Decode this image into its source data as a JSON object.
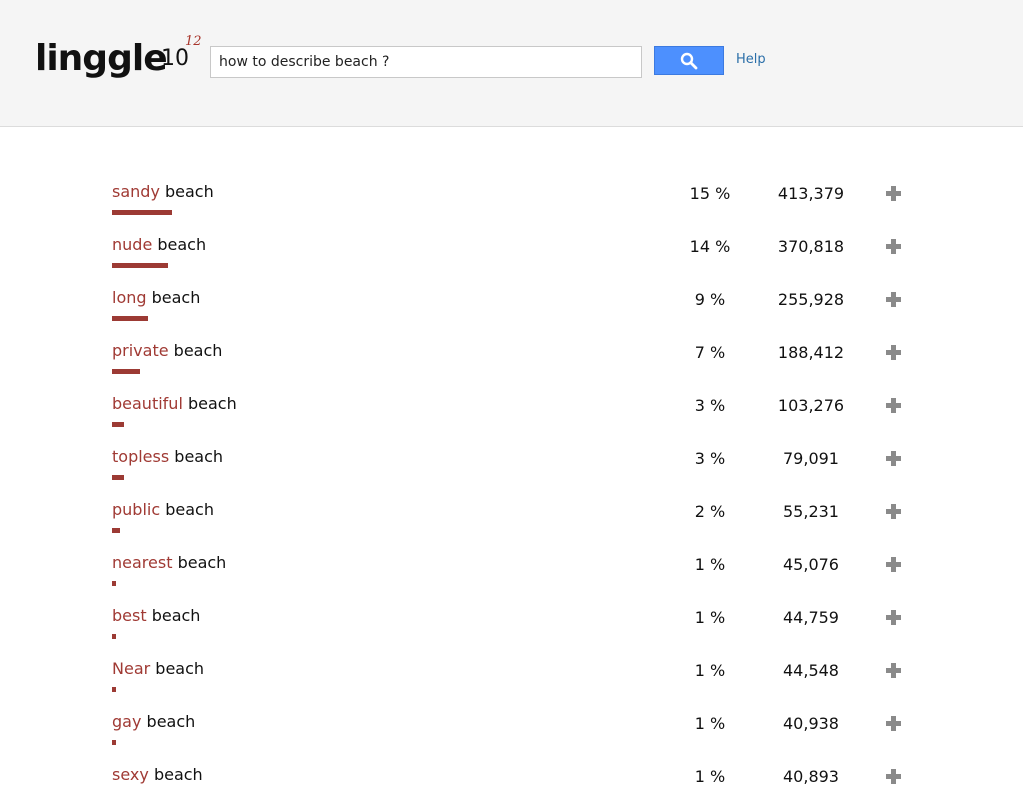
{
  "header": {
    "logo_text": "linggle",
    "logo_base": "10",
    "logo_exponent": "12",
    "search": {
      "value": "how to describe beach ?",
      "placeholder": ""
    },
    "search_button_icon": "search-icon",
    "help_label": "Help"
  },
  "colors": {
    "accent_red": "#a03a34",
    "search_blue": "#4d90fe",
    "link_blue": "#2a6ea8",
    "header_bg": "#f5f5f5"
  },
  "results": [
    {
      "modifier": "sandy",
      "head": "beach",
      "percent": "15 %",
      "count": "413,379",
      "share": 0.15
    },
    {
      "modifier": "nude",
      "head": "beach",
      "percent": "14 %",
      "count": "370,818",
      "share": 0.14
    },
    {
      "modifier": "long",
      "head": "beach",
      "percent": "9 %",
      "count": "255,928",
      "share": 0.09
    },
    {
      "modifier": "private",
      "head": "beach",
      "percent": "7 %",
      "count": "188,412",
      "share": 0.07
    },
    {
      "modifier": "beautiful",
      "head": "beach",
      "percent": "3 %",
      "count": "103,276",
      "share": 0.03
    },
    {
      "modifier": "topless",
      "head": "beach",
      "percent": "3 %",
      "count": "79,091",
      "share": 0.03
    },
    {
      "modifier": "public",
      "head": "beach",
      "percent": "2 %",
      "count": "55,231",
      "share": 0.02
    },
    {
      "modifier": "nearest",
      "head": "beach",
      "percent": "1 %",
      "count": "45,076",
      "share": 0.01
    },
    {
      "modifier": "best",
      "head": "beach",
      "percent": "1 %",
      "count": "44,759",
      "share": 0.01
    },
    {
      "modifier": "Near",
      "head": "beach",
      "percent": "1 %",
      "count": "44,548",
      "share": 0.01
    },
    {
      "modifier": "gay",
      "head": "beach",
      "percent": "1 %",
      "count": "40,938",
      "share": 0.01
    },
    {
      "modifier": "sexy",
      "head": "beach",
      "percent": "1 %",
      "count": "40,893",
      "share": 0.01
    }
  ]
}
